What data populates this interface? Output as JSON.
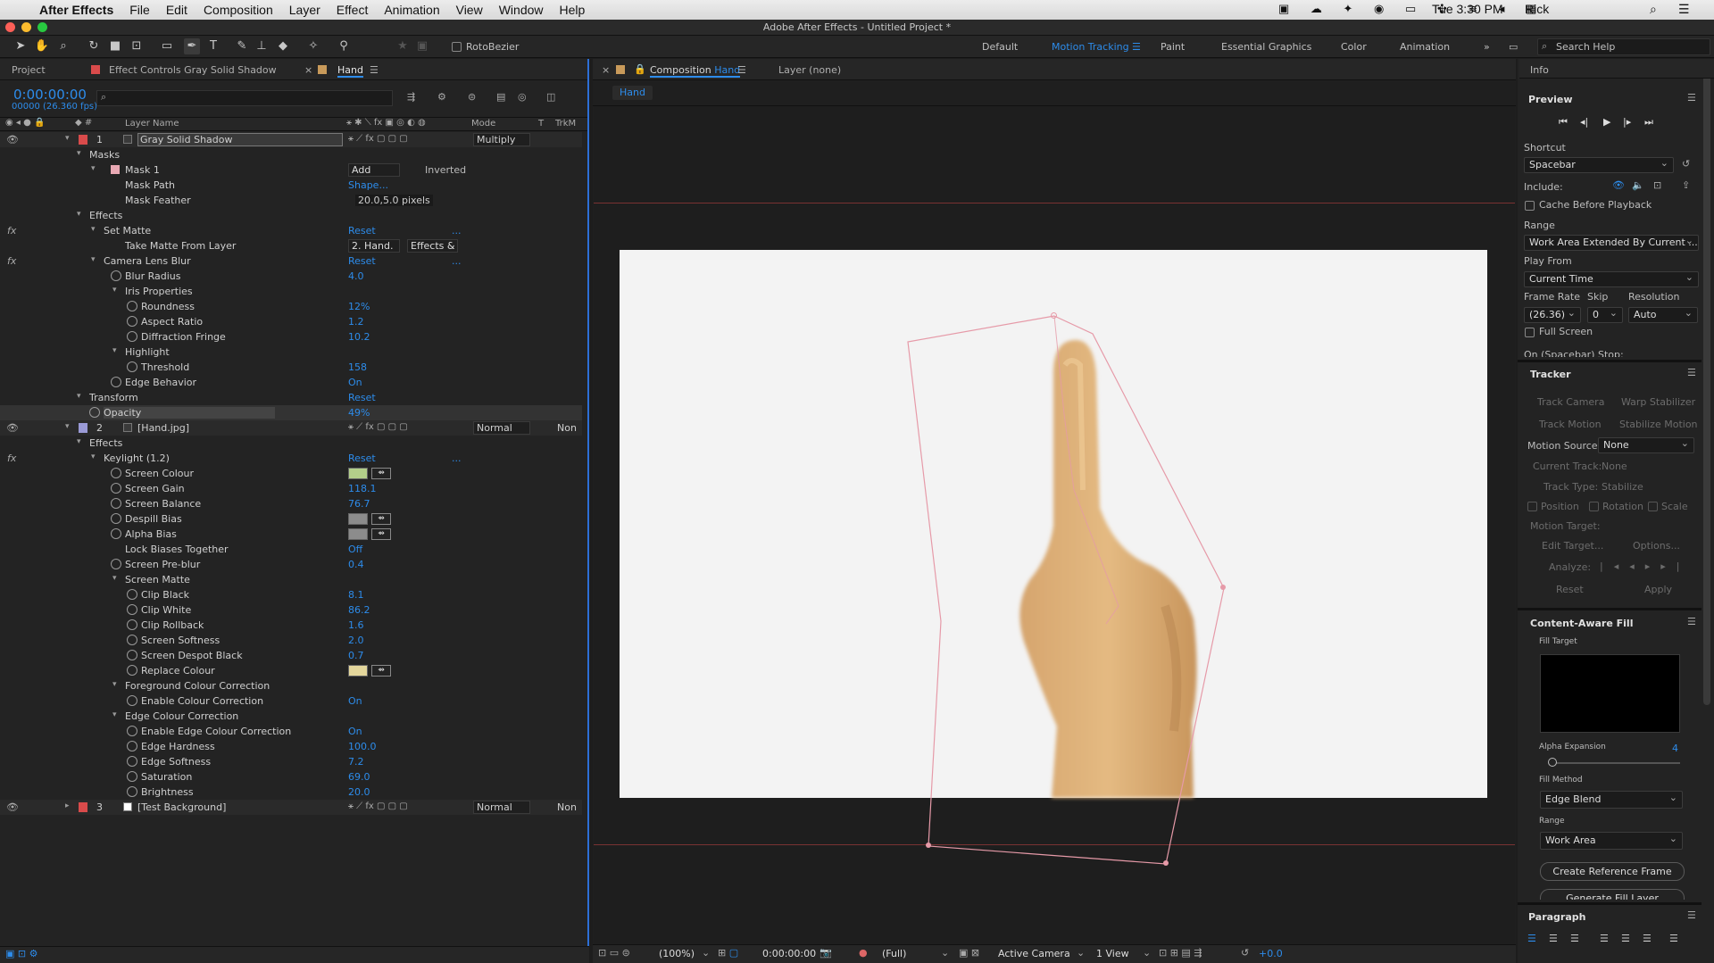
{
  "menubar": {
    "app": "After Effects",
    "items": [
      "File",
      "Edit",
      "Composition",
      "Layer",
      "Effect",
      "Animation",
      "View",
      "Window",
      "Help"
    ],
    "user": "Rick",
    "clock": "Tue 3:30 PM"
  },
  "window_title": "Adobe After Effects - Untitled Project *",
  "toolbar": {
    "rotobezier": "RotoBezier"
  },
  "workspaces": [
    "Default",
    "Motion Tracking",
    "Paint",
    "Essential Graphics",
    "Color",
    "Animation"
  ],
  "search_help": "Search Help",
  "timeline": {
    "tabs": {
      "project": "Project",
      "effect_controls": "Effect Controls Gray Solid Shadow",
      "comp": "Hand"
    },
    "timecode": "0:00:00:00",
    "frame_info": "00000 (26.360 fps)",
    "col_layer_name": "Layer Name",
    "col_mode": "Mode",
    "col_t": "T",
    "col_trkmat": "TrkM",
    "rows": [
      {
        "indent": 0,
        "num": "1",
        "name": "Gray Solid Shadow",
        "mode": "Multiply",
        "color": "#d94b4b",
        "type": "layer"
      },
      {
        "indent": 1,
        "label": "Masks"
      },
      {
        "indent": 2,
        "label": "Mask 1",
        "value": "Add",
        "extra": "Inverted"
      },
      {
        "indent": 3,
        "label": "Mask Path",
        "value": "Shape..."
      },
      {
        "indent": 3,
        "label": "Mask Feather",
        "value": "20.0,5.0 pixels",
        "valwhite": true
      },
      {
        "indent": 1,
        "label": "Effects"
      },
      {
        "indent": 2,
        "label": "Set Matte",
        "value": "Reset",
        "fx": true,
        "dots": "..."
      },
      {
        "indent": 3,
        "label": "Take Matte From Layer",
        "value": "2. Hand.",
        "extra": "Effects &"
      },
      {
        "indent": 2,
        "label": "Camera Lens Blur",
        "value": "Reset",
        "fx": true,
        "dots": "..."
      },
      {
        "indent": 3,
        "label": "Blur Radius",
        "value": "4.0",
        "sw": true
      },
      {
        "indent": 3,
        "label": "Iris Properties"
      },
      {
        "indent": 4,
        "label": "Roundness",
        "value": "12%",
        "sw": true
      },
      {
        "indent": 4,
        "label": "Aspect Ratio",
        "value": "1.2",
        "sw": true
      },
      {
        "indent": 4,
        "label": "Diffraction Fringe",
        "value": "10.2",
        "sw": true
      },
      {
        "indent": 3,
        "label": "Highlight"
      },
      {
        "indent": 4,
        "label": "Threshold",
        "value": "158",
        "sw": true
      },
      {
        "indent": 3,
        "label": "Edge Behavior",
        "value": "On",
        "sw": true
      },
      {
        "indent": 1,
        "label": "Transform",
        "value": "Reset"
      },
      {
        "indent": 2,
        "label": "Opacity",
        "value": "49%",
        "sw": true,
        "sel": true
      },
      {
        "indent": 0,
        "num": "2",
        "name": "[Hand.jpg]",
        "mode": "Normal",
        "trk": "Non",
        "color": "#9a9ad6",
        "type": "layer"
      },
      {
        "indent": 1,
        "label": "Effects"
      },
      {
        "indent": 2,
        "label": "Keylight (1.2)",
        "value": "Reset",
        "fx": true,
        "dots": "..."
      },
      {
        "indent": 3,
        "label": "Screen Colour",
        "swatch": "#b3cf8a",
        "sw": true
      },
      {
        "indent": 3,
        "label": "Screen Gain",
        "value": "118.1",
        "sw": true
      },
      {
        "indent": 3,
        "label": "Screen Balance",
        "value": "76.7",
        "sw": true
      },
      {
        "indent": 3,
        "label": "Despill Bias",
        "swatch": "#8c8c8c",
        "sw": true
      },
      {
        "indent": 3,
        "label": "Alpha Bias",
        "swatch": "#8c8c8c",
        "sw": true
      },
      {
        "indent": 3,
        "label": "Lock Biases Together",
        "value": "Off"
      },
      {
        "indent": 3,
        "label": "Screen Pre-blur",
        "value": "0.4",
        "sw": true
      },
      {
        "indent": 3,
        "label": "Screen Matte"
      },
      {
        "indent": 4,
        "label": "Clip Black",
        "value": "8.1",
        "sw": true
      },
      {
        "indent": 4,
        "label": "Clip White",
        "value": "86.2",
        "sw": true
      },
      {
        "indent": 4,
        "label": "Clip Rollback",
        "value": "1.6",
        "sw": true
      },
      {
        "indent": 4,
        "label": "Screen Softness",
        "value": "2.0",
        "sw": true
      },
      {
        "indent": 4,
        "label": "Screen Despot Black",
        "value": "0.7",
        "sw": true
      },
      {
        "indent": 4,
        "label": "Replace Colour",
        "swatch": "#e4d79c",
        "sw": true
      },
      {
        "indent": 3,
        "label": "Foreground Colour Correction"
      },
      {
        "indent": 4,
        "label": "Enable Colour Correction",
        "value": "On",
        "sw": true
      },
      {
        "indent": 3,
        "label": "Edge Colour Correction"
      },
      {
        "indent": 4,
        "label": "Enable Edge Colour Correction",
        "value": "On",
        "sw": true
      },
      {
        "indent": 4,
        "label": "Edge Hardness",
        "value": "100.0",
        "sw": true
      },
      {
        "indent": 4,
        "label": "Edge Softness",
        "value": "7.2",
        "sw": true
      },
      {
        "indent": 4,
        "label": "Saturation",
        "value": "69.0",
        "sw": true
      },
      {
        "indent": 4,
        "label": "Brightness",
        "value": "20.0",
        "sw": true
      },
      {
        "indent": 0,
        "num": "3",
        "name": "[Test Background]",
        "mode": "Normal",
        "trk": "Non",
        "color": "#d94b4b",
        "type": "layer",
        "collapsed": true
      }
    ]
  },
  "composition": {
    "tab": "Composition",
    "tab_name": "Hand",
    "layer_tab": "Layer (none)",
    "breadcrumb": "Hand",
    "bottom": {
      "zoom": "(100%)",
      "timecode": "0:00:00:00",
      "resolution": "(Full)",
      "camera": "Active Camera",
      "views": "1 View",
      "exposure": "+0.0"
    }
  },
  "info_panel": {
    "title": "Info"
  },
  "preview": {
    "title": "Preview",
    "shortcut_label": "Shortcut",
    "shortcut": "Spacebar",
    "include_label": "Include:",
    "cache_label": "Cache Before Playback",
    "range_label": "Range",
    "range": "Work Area Extended By Current ...",
    "play_from_label": "Play From",
    "play_from": "Current Time",
    "frame_rate_label": "Frame Rate",
    "frame_rate": "(26.36)",
    "skip_label": "Skip",
    "skip": "0",
    "resolution_label": "Resolution",
    "resolution": "Auto",
    "full_screen_label": "Full Screen",
    "stop_label": "On (Spacebar) Stop:"
  },
  "tracker": {
    "title": "Tracker",
    "track_camera": "Track Camera",
    "warp_stabilizer": "Warp Stabilizer",
    "track_motion": "Track Motion",
    "stabilize_motion": "Stabilize Motion",
    "motion_source_label": "Motion Source:",
    "motion_source": "None",
    "current_track_label": "Current Track:",
    "current_track": "None",
    "track_type_label": "Track Type:",
    "track_type": "Stabilize",
    "position": "Position",
    "rotation": "Rotation",
    "scale": "Scale",
    "motion_target": "Motion Target:",
    "edit_target": "Edit Target...",
    "options": "Options...",
    "analyze": "Analyze:",
    "reset": "Reset",
    "apply": "Apply"
  },
  "caf": {
    "title": "Content-Aware Fill",
    "fill_target": "Fill Target",
    "alpha_expansion_label": "Alpha Expansion",
    "alpha_expansion": "4",
    "fill_method_label": "Fill Method",
    "fill_method": "Edge Blend",
    "range_label": "Range",
    "range": "Work Area",
    "create_ref": "Create Reference Frame",
    "generate": "Generate Fill Layer"
  },
  "paragraph": {
    "title": "Paragraph"
  }
}
